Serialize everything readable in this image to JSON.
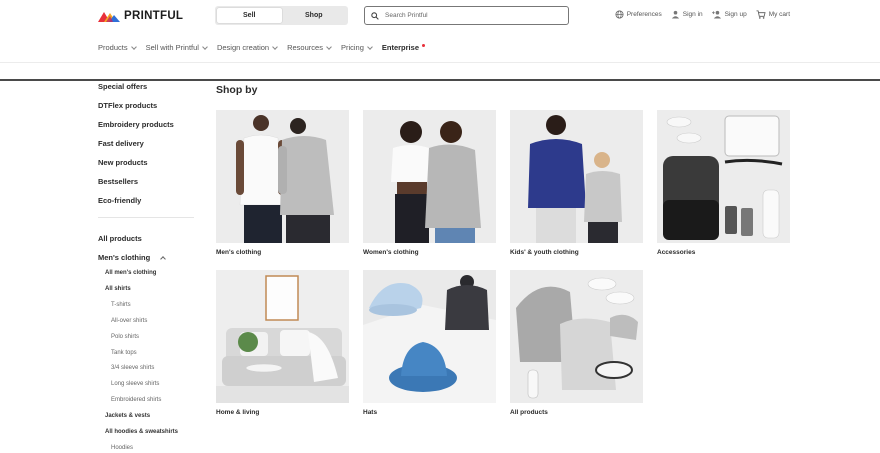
{
  "header": {
    "logo_text": "PRINTFUL",
    "toggle": {
      "sell": "Sell",
      "shop": "Shop",
      "active": "shop"
    },
    "search": {
      "placeholder": "Search Printful",
      "value": ""
    },
    "utils": {
      "preferences": "Preferences",
      "sign_in": "Sign in",
      "sign_up": "Sign up",
      "cart": "My cart"
    }
  },
  "nav": {
    "items": [
      {
        "label": "Products",
        "dropdown": true
      },
      {
        "label": "Sell with Printful",
        "dropdown": true
      },
      {
        "label": "Design creation",
        "dropdown": true
      },
      {
        "label": "Resources",
        "dropdown": true
      },
      {
        "label": "Pricing",
        "dropdown": true
      },
      {
        "label": "Enterprise",
        "dropdown": false,
        "badge_color": "#e8303a"
      }
    ]
  },
  "sidebar": {
    "top_links": [
      "Special offers",
      "DTFlex products",
      "Embroidery products",
      "Fast delivery",
      "New products",
      "Bestsellers",
      "Eco-friendly"
    ],
    "all_products": "All products",
    "mens_clothing": "Men's clothing",
    "sub_items": [
      "All men's clothing",
      "All shirts",
      "T-shirts",
      "All-over shirts",
      "Polo shirts",
      "Tank tops",
      "3/4 sleeve shirts",
      "Long sleeve shirts",
      "Embroidered shirts",
      "Jackets & vests",
      "All hoodies & sweatshirts",
      "Hoodies"
    ]
  },
  "main": {
    "title": "Shop by",
    "categories": [
      {
        "label": "Men's clothing",
        "icon": "men-clothing-image"
      },
      {
        "label": "Women's clothing",
        "icon": "women-clothing-image"
      },
      {
        "label": "Kids' & youth clothing",
        "icon": "kids-clothing-image"
      },
      {
        "label": "Accessories",
        "icon": "accessories-image"
      },
      {
        "label": "Home & living",
        "icon": "home-living-image"
      },
      {
        "label": "Hats",
        "icon": "hats-image"
      },
      {
        "label": "All products",
        "icon": "all-products-image"
      }
    ]
  },
  "colors": {
    "logo_red": "#e8303a",
    "logo_orange": "#f5a623",
    "logo_blue": "#2f6fd8",
    "text_dark": "#2b2b2b",
    "bg_tile": "#ececec"
  }
}
